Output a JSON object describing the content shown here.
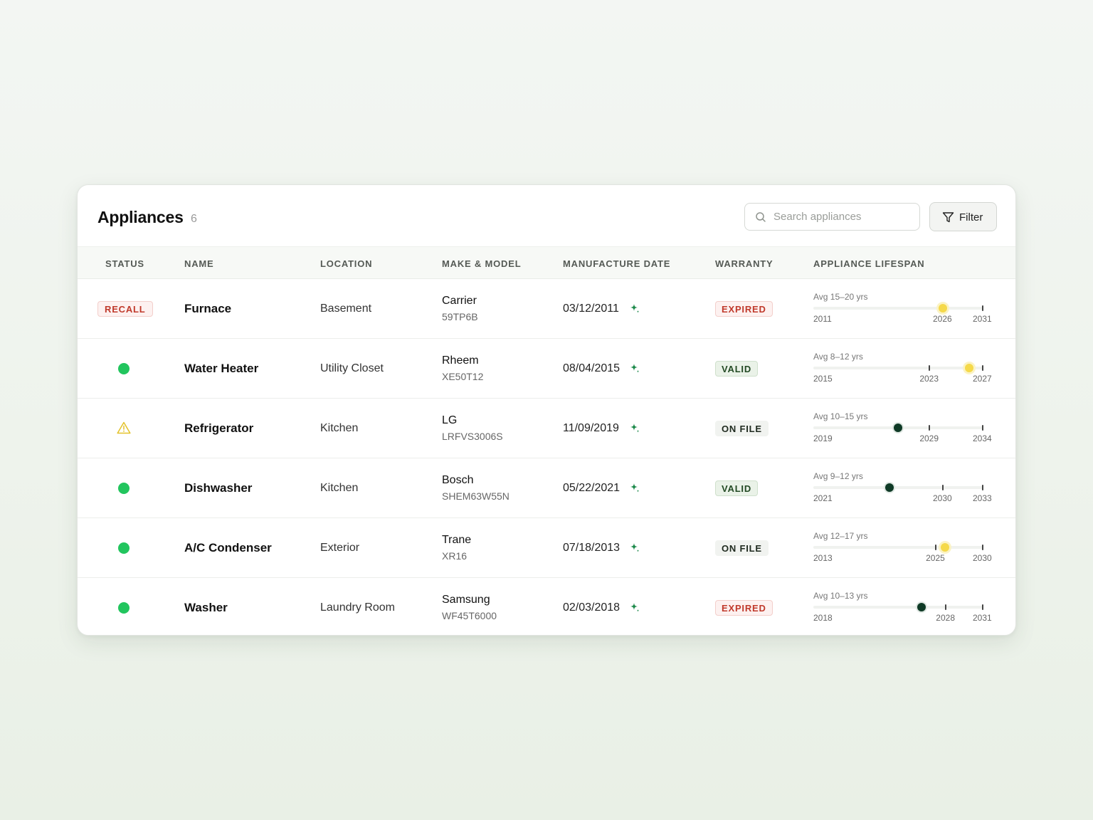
{
  "header": {
    "title": "Appliances",
    "count": "6",
    "search_placeholder": "Search appliances",
    "filter_label": "Filter"
  },
  "columns": [
    "STATUS",
    "NAME",
    "LOCATION",
    "MAKE & MODEL",
    "MANUFACTURE DATE",
    "WARRANTY",
    "APPLIANCE LIFESPAN"
  ],
  "colors": {
    "status_ok": "#22c55e",
    "recall": "#c0392b",
    "warning": "#e0c12a",
    "marker_yellow": "#f5d94a",
    "marker_dark": "#0f3a26",
    "sparkle": "#1f8a4c"
  },
  "rows": [
    {
      "status": "recall",
      "status_label": "RECALL",
      "name": "Furnace",
      "location": "Basement",
      "make": "Carrier",
      "model": "59TP6B",
      "manufacture_date": "03/12/2011",
      "warranty": "EXPIRED",
      "warranty_type": "expired",
      "lifespan": {
        "avg": "Avg 15–20 yrs",
        "start": "2011",
        "mid": "2026",
        "end": "2031",
        "marker_year": "2026",
        "marker_color": "yellow"
      }
    },
    {
      "status": "ok",
      "status_label": "",
      "name": "Water Heater",
      "location": "Utility Closet",
      "make": "Rheem",
      "model": "XE50T12",
      "manufacture_date": "08/04/2015",
      "warranty": "VALID",
      "warranty_type": "valid",
      "lifespan": {
        "avg": "Avg 8–12 yrs",
        "start": "2015",
        "mid": "2023",
        "end": "2027",
        "marker_year": "2026",
        "marker_color": "yellow"
      }
    },
    {
      "status": "warning",
      "status_label": "",
      "name": "Refrigerator",
      "location": "Kitchen",
      "make": "LG",
      "model": "LRFVS3006S",
      "manufacture_date": "11/09/2019",
      "warranty": "ON FILE",
      "warranty_type": "onfile",
      "lifespan": {
        "avg": "Avg 10–15 yrs",
        "start": "2019",
        "mid": "2029",
        "end": "2034",
        "marker_year": "2026",
        "marker_color": "dark"
      }
    },
    {
      "status": "ok",
      "status_label": "",
      "name": "Dishwasher",
      "location": "Kitchen",
      "make": "Bosch",
      "model": "SHEM63W55N",
      "manufacture_date": "05/22/2021",
      "warranty": "VALID",
      "warranty_type": "valid",
      "lifespan": {
        "avg": "Avg 9–12 yrs",
        "start": "2021",
        "mid": "2030",
        "end": "2033",
        "marker_year": "2026",
        "marker_color": "dark"
      }
    },
    {
      "status": "ok",
      "status_label": "",
      "name": "A/C Condenser",
      "location": "Exterior",
      "make": "Trane",
      "model": "XR16",
      "manufacture_date": "07/18/2013",
      "warranty": "ON FILE",
      "warranty_type": "onfile",
      "lifespan": {
        "avg": "Avg 12–17 yrs",
        "start": "2013",
        "mid": "2025",
        "end": "2030",
        "marker_year": "2026",
        "marker_color": "yellow"
      }
    },
    {
      "status": "ok",
      "status_label": "",
      "name": "Washer",
      "location": "Laundry Room",
      "make": "Samsung",
      "model": "WF45T6000",
      "manufacture_date": "02/03/2018",
      "warranty": "EXPIRED",
      "warranty_type": "expired",
      "lifespan": {
        "avg": "Avg 10–13 yrs",
        "start": "2018",
        "mid": "2028",
        "end": "2031",
        "marker_year": "2026",
        "marker_color": "dark"
      }
    }
  ]
}
